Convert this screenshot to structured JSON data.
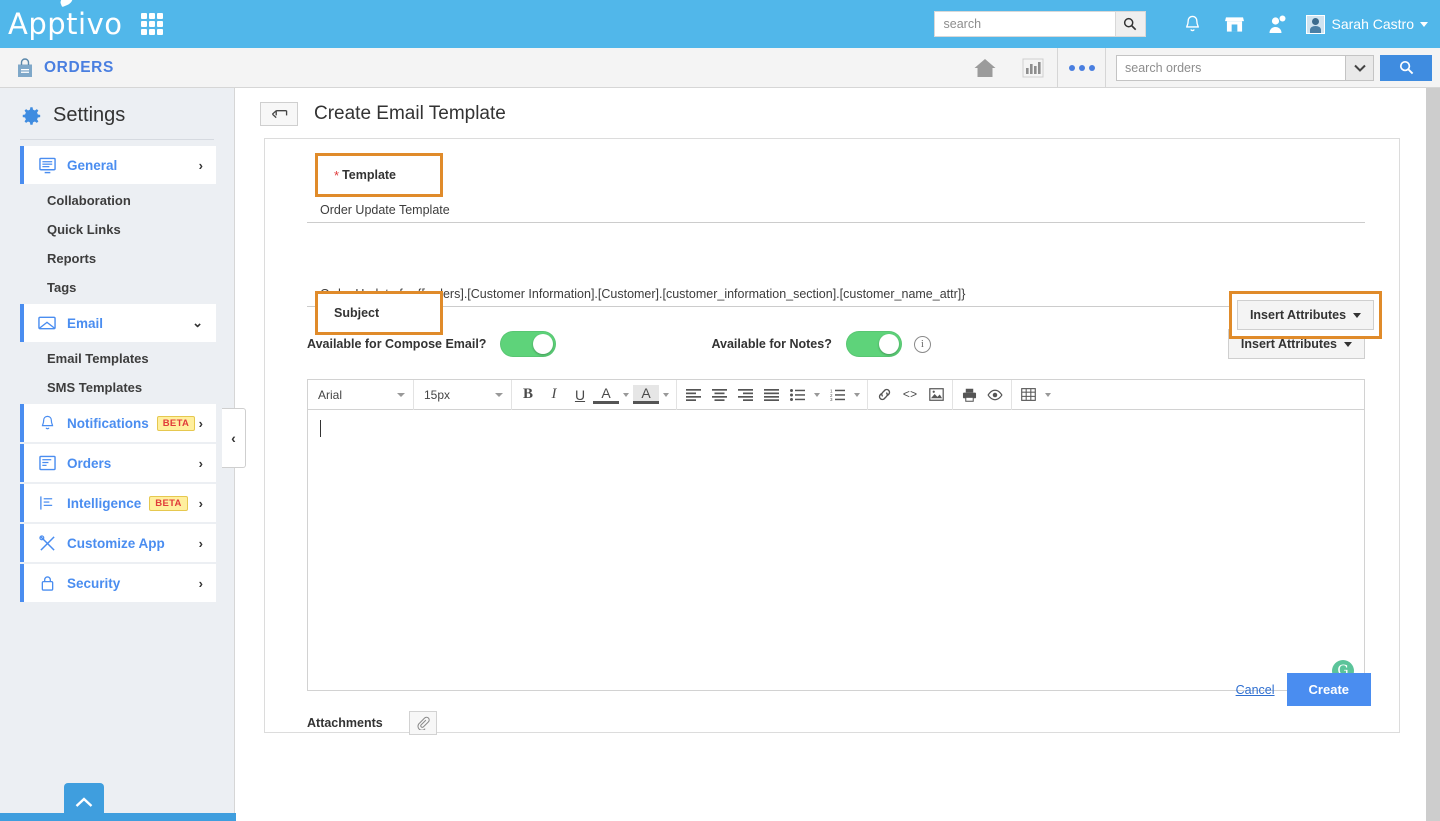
{
  "topbar": {
    "brand": "Apptivo",
    "apps_grid_icon": "grid-apps-icon",
    "search": {
      "placeholder": "search",
      "value": "",
      "search_icon": "search-icon"
    },
    "icons": [
      "bell-icon",
      "store-icon",
      "person-add-icon"
    ],
    "user": {
      "name": "Sarah Castro",
      "caret": "chevron-down-icon",
      "avatar": "avatar-icon"
    }
  },
  "approw": {
    "app_icon": "shopping-bag-icon",
    "app_name": "ORDERS",
    "home_icon": "home-icon",
    "reports_icon": "bar-chart-icon",
    "more_icon": "ellipsis-icon",
    "search": {
      "placeholder": "search orders",
      "value": "",
      "dropdown_icon": "chevron-down-icon",
      "button_icon": "search-icon"
    }
  },
  "sidebar": {
    "title": "Settings",
    "gear_icon": "gear-icon",
    "collapse_icon": "chevron-left-icon",
    "scroll_top_icon": "chevron-up-icon",
    "nav": [
      {
        "label": "General",
        "icon": "general-screen-icon",
        "expanded": true,
        "chevron": "›",
        "badge": ""
      },
      {
        "label": "Email",
        "icon": "envelope-icon",
        "expanded": true,
        "chevron": "⌄",
        "badge": ""
      },
      {
        "label": "Notifications",
        "icon": "bell-icon",
        "expanded": false,
        "chevron": "›",
        "badge": "BETA"
      },
      {
        "label": "Orders",
        "icon": "orders-list-icon",
        "expanded": false,
        "chevron": "›",
        "badge": ""
      },
      {
        "label": "Intelligence",
        "icon": "intelligence-lines-icon",
        "expanded": false,
        "chevron": "›",
        "badge": "BETA"
      },
      {
        "label": "Customize App",
        "icon": "tools-icon",
        "expanded": false,
        "chevron": "›",
        "badge": ""
      },
      {
        "label": "Security",
        "icon": "lock-icon",
        "expanded": false,
        "chevron": "›",
        "badge": ""
      }
    ],
    "general_sub": [
      "Collaboration",
      "Quick Links",
      "Reports",
      "Tags"
    ],
    "email_sub": [
      "Email Templates",
      "SMS Templates"
    ]
  },
  "page": {
    "back_icon": "back-arrow-icon",
    "title": "Create Email Template"
  },
  "form": {
    "template_label": "Template",
    "template_required": "*",
    "template_value": "Order Update Template",
    "subject_label": "Subject",
    "subject_value": "Order Update for {[orders].[Customer Information].[Customer].[customer_information_section].[customer_name_attr]}",
    "insert_attributes_label": "Insert Attributes",
    "compose_toggle_label": "Available for Compose Email?",
    "compose_toggle_state": "on",
    "notes_toggle_label": "Available for Notes?",
    "notes_toggle_state": "on",
    "info_icon": "info-icon",
    "attachments_label": "Attachments",
    "attachment_icon": "paperclip-icon"
  },
  "editor": {
    "font_family": "Arial",
    "font_size": "15px",
    "body_text": "",
    "grammarly_badge": "G",
    "tools": [
      "bold-icon",
      "italic-icon",
      "underline-icon",
      "text-color-icon",
      "highlight-color-icon",
      "align-left-icon",
      "align-center-icon",
      "align-right-icon",
      "align-justify-icon",
      "bullet-list-icon",
      "numbered-list-icon",
      "link-icon",
      "code-icon",
      "image-icon",
      "print-icon",
      "preview-eye-icon",
      "table-icon"
    ]
  },
  "footer": {
    "cancel_label": "Cancel",
    "create_label": "Create"
  },
  "colors": {
    "topbar_blue": "#51b7ea",
    "accent_blue": "#4a8df0",
    "highlight_orange": "#e08b2a",
    "toggle_green": "#5ed37a",
    "beta_yellow": "#ffef9e",
    "beta_red": "#e03b3b"
  }
}
